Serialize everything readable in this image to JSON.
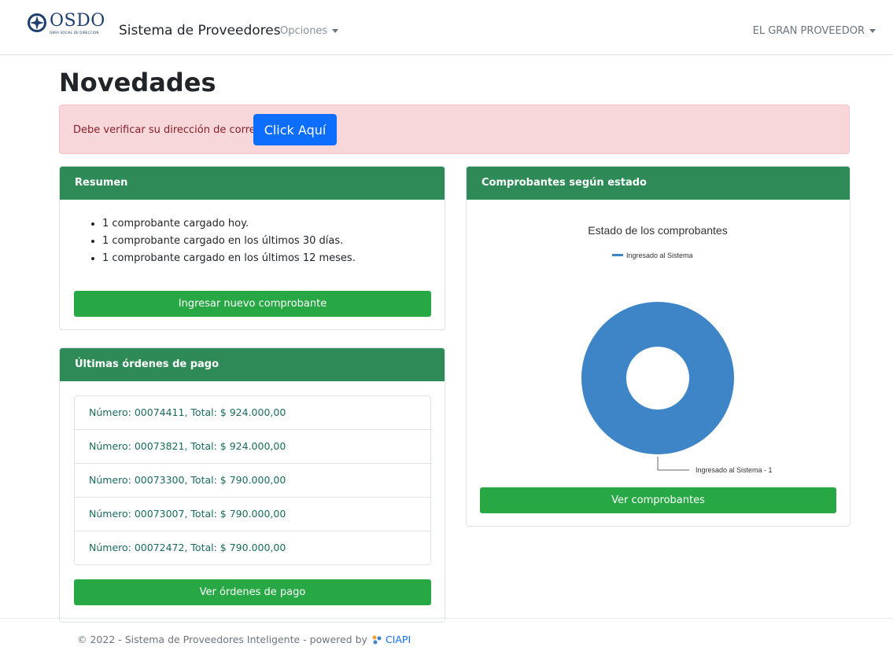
{
  "navbar": {
    "logo_text": "OSDO",
    "logo_subtext": "OBRA SOCIAL DE DIRECCION",
    "app_title": "Sistema de Proveedores",
    "options_label": "Opciones",
    "user_label": "EL GRAN PROVEEDOR"
  },
  "page": {
    "title": "Novedades"
  },
  "alert": {
    "text": "Debe verificar su dirección de correo",
    "button_label": "Click Aquí"
  },
  "resumen": {
    "header": "Resumen",
    "items": [
      "1 comprobante cargado hoy.",
      "1 comprobante cargado en los últimos 30 días.",
      "1 comprobante cargado en los últimos 12 meses."
    ],
    "button_label": "Ingresar nuevo comprobante"
  },
  "ordenes": {
    "header": "Últimas órdenes de pago",
    "items": [
      "Número: 00074411, Total: $ 924.000,00",
      "Número: 00073821, Total: $ 924.000,00",
      "Número: 00073300, Total: $ 790.000,00",
      "Número: 00073007, Total: $ 790.000,00",
      "Número: 00072472, Total: $ 790.000,00"
    ],
    "button_label": "Ver órdenes de pago"
  },
  "comprobantes": {
    "header": "Comprobantes según estado",
    "button_label": "Ver comprobantes"
  },
  "chart_data": {
    "type": "pie",
    "title": "Estado de los comprobantes",
    "legend_position": "top",
    "categories": [
      "Ingresado al Sistema"
    ],
    "values": [
      1
    ],
    "colors": [
      "#3d85c6"
    ],
    "data_labels": [
      "Ingresado al Sistema - 1"
    ],
    "donut": true
  },
  "footer": {
    "text": "© 2022 - Sistema de Proveedores Inteligente - powered by",
    "brand": "CIAPI"
  },
  "colors": {
    "header_green": "#2e8b57",
    "button_green": "#28a745",
    "primary_blue": "#0d6efd",
    "alert_bg": "#f8d7da"
  }
}
